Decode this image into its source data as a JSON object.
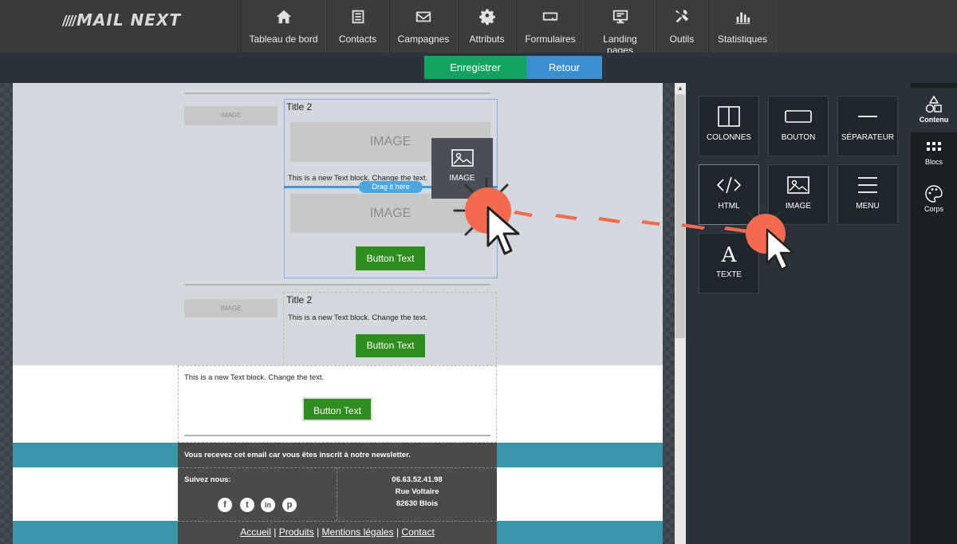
{
  "app": {
    "logo_text": "MAIL NEXT"
  },
  "nav": [
    {
      "label": "Tableau de bord",
      "icon": "home-icon"
    },
    {
      "label": "Contacts",
      "icon": "list-icon"
    },
    {
      "label": "Campagnes",
      "icon": "envelope-icon"
    },
    {
      "label": "Attributs",
      "icon": "gear-icon"
    },
    {
      "label": "Formulaires",
      "icon": "form-icon"
    },
    {
      "label": "Landing pages",
      "icon": "monitor-icon"
    },
    {
      "label": "Outils",
      "icon": "tools-icon"
    },
    {
      "label": "Statistiques",
      "icon": "bar-chart-icon"
    }
  ],
  "actions": {
    "save": "Enregistrer",
    "back": "Retour"
  },
  "email": {
    "image_small": "IMAGE",
    "image_large": "IMAGE",
    "block1": {
      "title": "Title 2",
      "text": "This is a new Text block. Change the text.",
      "button": "Button Text"
    },
    "drop_hint": "Drag it here",
    "block2": {
      "title": "Title 2",
      "text": "This is a new Text block. Change the text.",
      "button": "Button Text"
    },
    "block3": {
      "text": "This is a new Text block. Change the text.",
      "button": "Button Text"
    },
    "footer": {
      "notice": "Vous recevez cet email car vous êtes inscrit à notre newsletter.",
      "follow": "Suivez nous:",
      "phone": "06.63.52.41.98",
      "street": "Rue Voltaire",
      "city": "82630 Blois",
      "links": [
        "Accueil",
        "Produits",
        "Mentions légales",
        "Contact"
      ],
      "separator": "|"
    }
  },
  "drag_tile": {
    "label": "IMAGE",
    "icon": "image-icon"
  },
  "panel": {
    "tiles": [
      {
        "label": "COLONNES",
        "icon": "columns-icon"
      },
      {
        "label": "BOUTON",
        "icon": "button-icon"
      },
      {
        "label": "SÉPARATEUR",
        "icon": "separator-icon"
      },
      {
        "label": "HTML",
        "icon": "code-icon"
      },
      {
        "label": "IMAGE",
        "icon": "image-icon"
      },
      {
        "label": "MENU",
        "icon": "menu-icon"
      },
      {
        "label": "TEXTE",
        "icon": "text-icon"
      }
    ],
    "tabs": [
      {
        "label": "Contenu",
        "icon": "shapes-icon"
      },
      {
        "label": "Blocs",
        "icon": "grid-icon"
      },
      {
        "label": "Corps",
        "icon": "palette-icon"
      }
    ]
  },
  "colors": {
    "accent_green": "#12a35f",
    "accent_blue": "#3b8fd0",
    "teal": "#3a96a8",
    "cursor_orange": "#f26b4f"
  }
}
